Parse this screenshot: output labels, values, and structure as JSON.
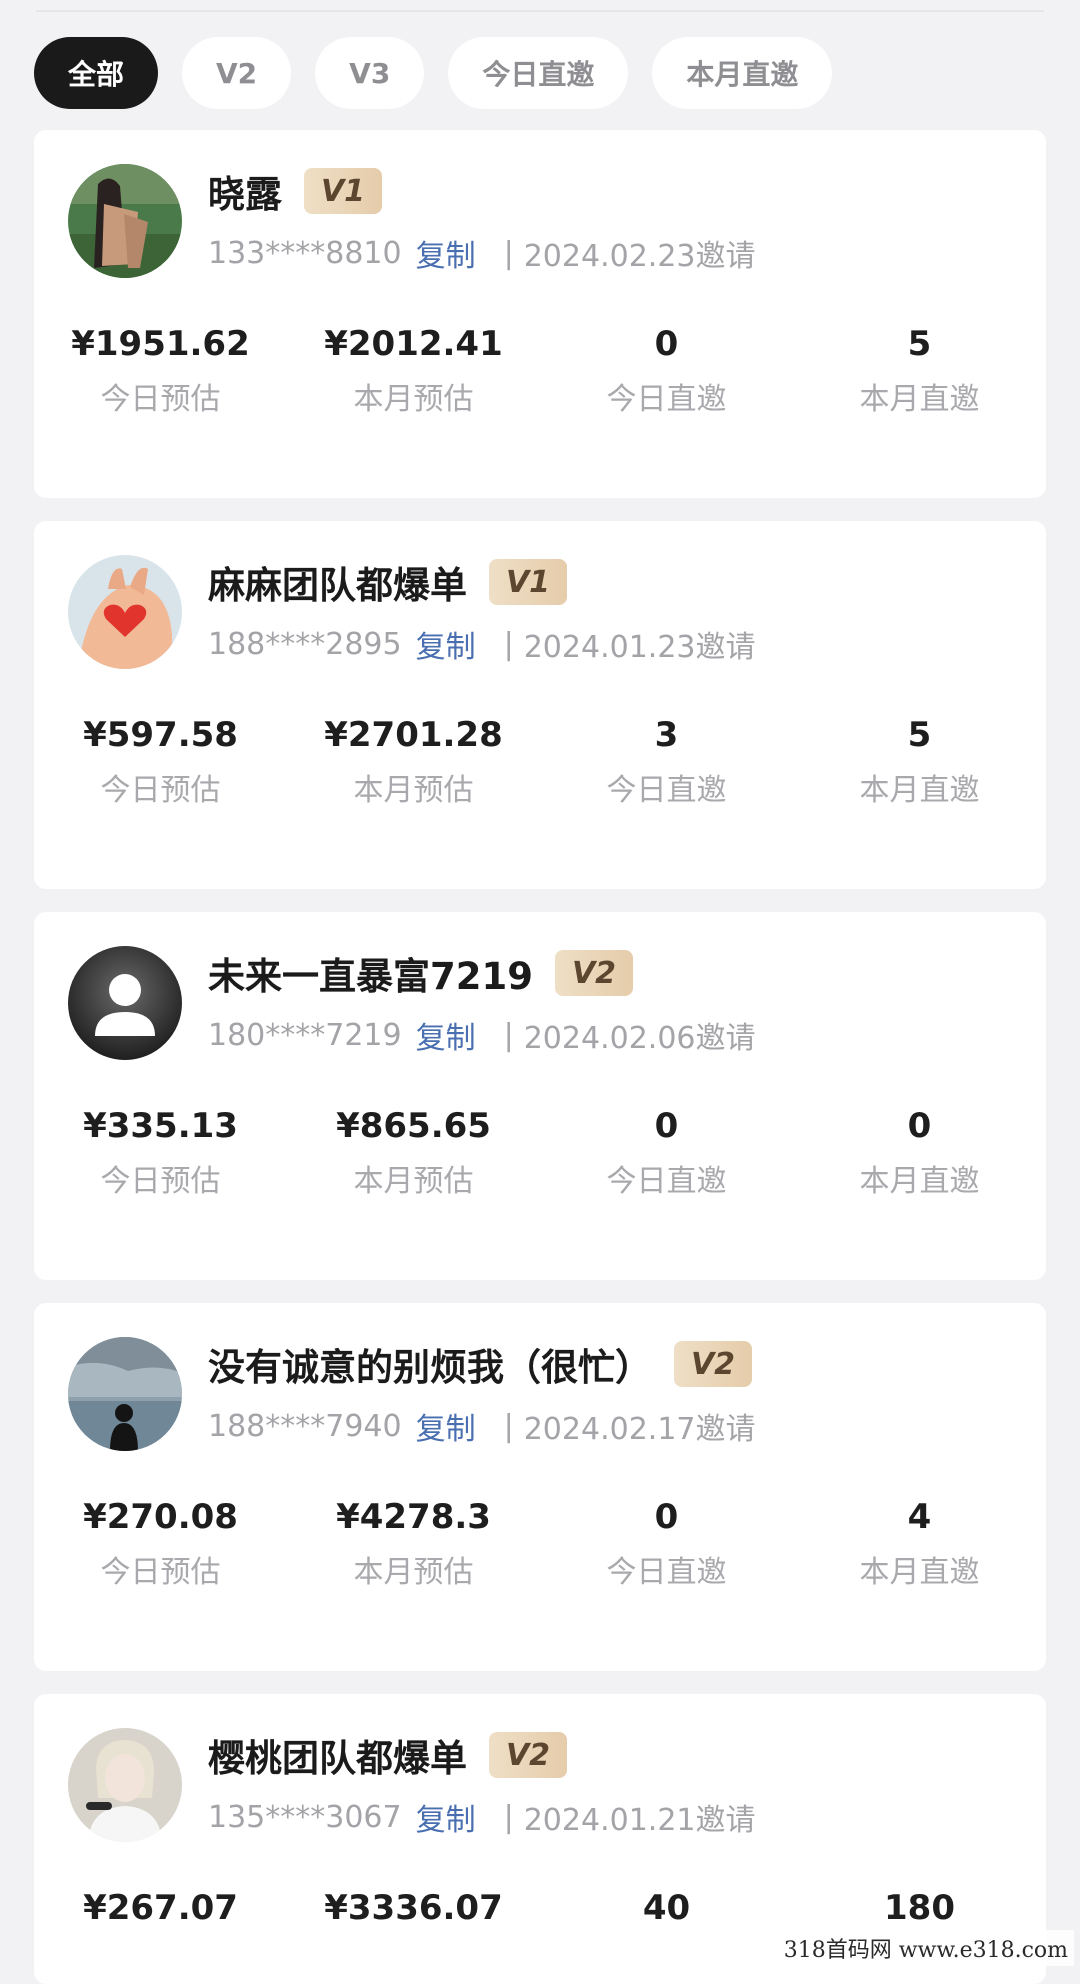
{
  "tabs": [
    "全部",
    "V2",
    "V3",
    "今日直邀",
    "本月直邀"
  ],
  "stat_labels": [
    "今日预估",
    "本月预估",
    "今日直邀",
    "本月直邀"
  ],
  "copy_label": "复制",
  "members": [
    {
      "name": "晓露",
      "level": "V1",
      "phone": "133****8810",
      "invite": "2024.02.23邀请",
      "today_est": "¥1951.62",
      "month_est": "¥2012.41",
      "today_invites": "0",
      "month_invites": "5"
    },
    {
      "name": "麻麻团队都爆单",
      "level": "V1",
      "phone": "188****2895",
      "invite": "2024.01.23邀请",
      "today_est": "¥597.58",
      "month_est": "¥2701.28",
      "today_invites": "3",
      "month_invites": "5"
    },
    {
      "name": "未来一直暴富7219",
      "level": "V2",
      "phone": "180****7219",
      "invite": "2024.02.06邀请",
      "today_est": "¥335.13",
      "month_est": "¥865.65",
      "today_invites": "0",
      "month_invites": "0"
    },
    {
      "name": "没有诚意的别烦我（很忙）",
      "level": "V2",
      "phone": "188****7940",
      "invite": "2024.02.17邀请",
      "today_est": "¥270.08",
      "month_est": "¥4278.3",
      "today_invites": "0",
      "month_invites": "4"
    },
    {
      "name": "樱桃团队都爆单",
      "level": "V2",
      "phone": "135****3067",
      "invite": "2024.01.21邀请",
      "today_est": "¥267.07",
      "month_est": "¥3336.07",
      "today_invites": "40",
      "month_invites": "180"
    }
  ],
  "watermark": "318首码网  www.e318.com"
}
